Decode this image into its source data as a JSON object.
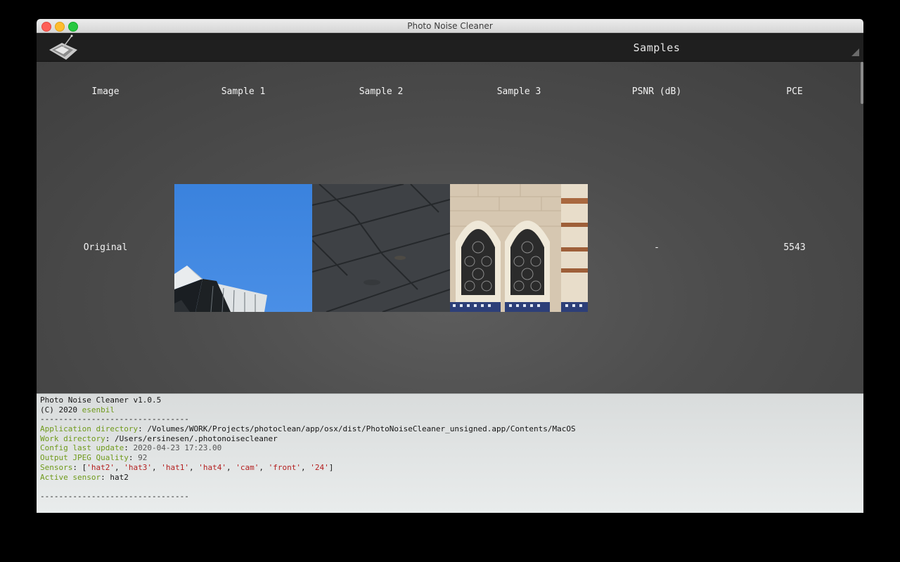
{
  "window": {
    "title": "Photo Noise Cleaner"
  },
  "toolbar": {
    "title": "Samples",
    "logo_icon": "app-logo-icon"
  },
  "table": {
    "headers": [
      "Image",
      "Sample 1",
      "Sample 2",
      "Sample 3",
      "PSNR (dB)",
      "PCE"
    ],
    "rows": [
      {
        "image": "Original",
        "psnr": "-",
        "pce": "5543"
      }
    ]
  },
  "console": {
    "line1": "Photo Noise Cleaner v1.0.5",
    "copyright_prefix": "(C) 2020 ",
    "copyright_author": "esenbil",
    "separator": "--------------------------------",
    "app_dir_label": "Application directory",
    "app_dir_value": "/Volumes/WORK/Projects/photoclean/app/osx/dist/PhotoNoiseCleaner_unsigned.app/Contents/MacOS",
    "work_dir_label": "Work directory",
    "work_dir_value": "/Users/ersinesen/.photonoisecleaner",
    "config_label": "Config last update",
    "config_value": "2020-04-23 17:23.00",
    "jpeg_label": "Output JPEG Quality",
    "jpeg_value": "92",
    "sensors_label": "Sensors",
    "sensors": [
      "'hat2'",
      "'hat3'",
      "'hat1'",
      "'hat4'",
      "'cam'",
      "'front'",
      "'24'"
    ],
    "active_label": "Active sensor",
    "active_value": "hat2",
    "separator2": "--------------------------------"
  },
  "colors": {
    "toolbar_bg": "#1f1f1f",
    "content_bg": "#474747",
    "console_bg": "#e3e6e6",
    "console_key": "#6f9a1b",
    "console_string": "#b42020"
  }
}
